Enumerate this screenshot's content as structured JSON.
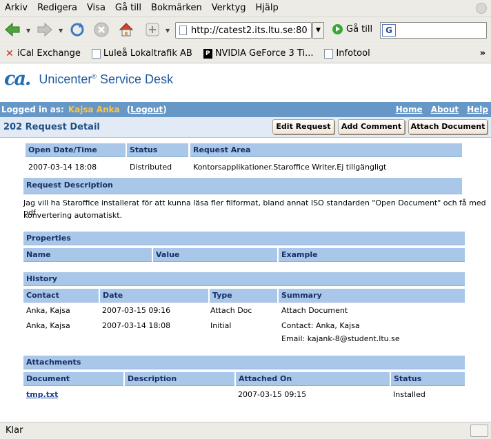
{
  "browser": {
    "menu": [
      "Arkiv",
      "Redigera",
      "Visa",
      "Gå till",
      "Bokmärken",
      "Verktyg",
      "Hjälp"
    ],
    "url": "http://catest2.its.ltu.se:80",
    "go_label": "Gå till",
    "search_engine_glyph": "G",
    "bookmarks": [
      "iCal Exchange",
      "Luleå Lokaltrafik AB",
      "NVIDIA GeForce 3 Ti...",
      "Infotool"
    ],
    "bookmarks_overflow": "»",
    "status_text": "Klar"
  },
  "app": {
    "logo": "ca.",
    "title": "Unicenter",
    "title_reg": "®",
    "title_suffix": " Service Desk",
    "logged_in_label": "Logged in as:",
    "user": "Kajsa Anka",
    "logout": "Logout",
    "open_paren": "(",
    "close_paren": ")",
    "links": [
      "Home",
      "About",
      "Help"
    ],
    "page_title": "202 Request Detail",
    "buttons": [
      "Edit Request",
      "Add Comment",
      "Attach Document"
    ]
  },
  "request": {
    "headers": [
      "Open Date/Time",
      "Status",
      "Request Area"
    ],
    "values": [
      "2007-03-14 18:08",
      "Distributed",
      "Kontorsapplikationer.Staroffice Writer.Ej tillgängligt"
    ],
    "description_label": "Request Description",
    "description_line1": "Jag vill ha Staroffice installerat för att kunna läsa fler filformat, bland annat ISO standarden \"Open Document\" och få med pdf",
    "description_line2": "konvertering automatiskt."
  },
  "properties": {
    "label": "Properties",
    "columns": [
      "Name",
      "Value",
      "Example"
    ]
  },
  "history": {
    "label": "History",
    "columns": [
      "Contact",
      "Date",
      "Type",
      "Summary"
    ],
    "rows": [
      {
        "contact": "Anka, Kajsa",
        "date": "2007-03-15 09:16",
        "type": "Attach Doc",
        "summary": "Attach Document",
        "summary2": ""
      },
      {
        "contact": "Anka, Kajsa",
        "date": "2007-03-14 18:08",
        "type": "Initial",
        "summary": "Contact: Anka, Kajsa",
        "summary2": "Email: kajank-8@student.ltu.se"
      }
    ]
  },
  "attachments": {
    "label": "Attachments",
    "columns": [
      "Document",
      "Description",
      "Attached On",
      "Status"
    ],
    "rows": [
      {
        "document": "tmp.txt",
        "description": "",
        "attached_on": "2007-03-15 09:15",
        "status": "Installed"
      }
    ]
  }
}
